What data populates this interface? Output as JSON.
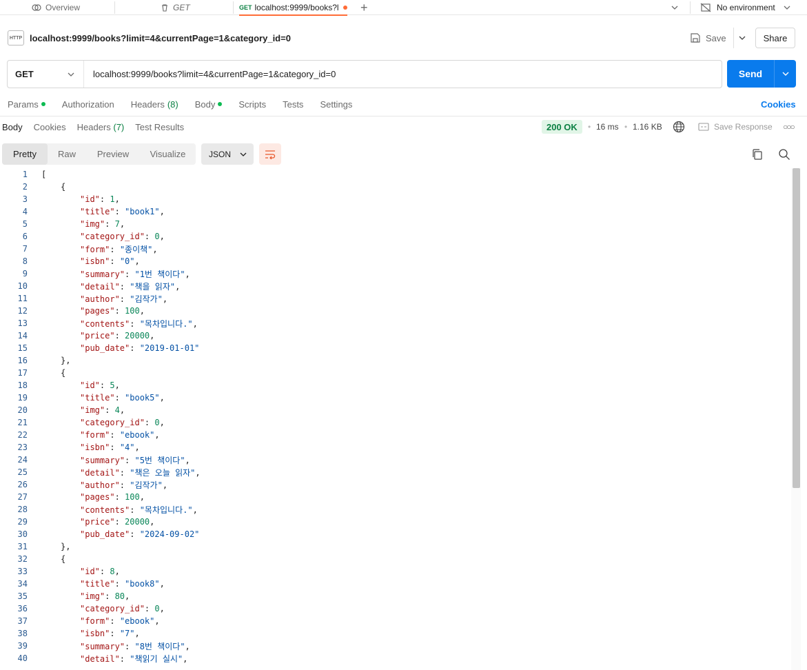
{
  "tabbar": {
    "tabs": [
      {
        "label": "Overview",
        "icon": "overview-icon"
      },
      {
        "label": "GET",
        "icon": "trash-icon"
      },
      {
        "method": "GET",
        "label": "localhost:9999/books?l",
        "icon": "unsaved-dot"
      }
    ],
    "environment": "No environment"
  },
  "request": {
    "badge": "HTTP",
    "name": "localhost:9999/books?limit=4&currentPage=1&category_id=0",
    "save_label": "Save",
    "share_label": "Share",
    "method": "GET",
    "url": "localhost:9999/books?limit=4&currentPage=1&category_id=0",
    "send_label": "Send",
    "tabs": [
      {
        "label": "Params",
        "dot": true
      },
      {
        "label": "Authorization"
      },
      {
        "label": "Headers",
        "count": "(8)"
      },
      {
        "label": "Body",
        "dot": true
      },
      {
        "label": "Scripts"
      },
      {
        "label": "Tests"
      },
      {
        "label": "Settings"
      }
    ],
    "cookies_label": "Cookies"
  },
  "response": {
    "tabs": [
      {
        "label": "Body"
      },
      {
        "label": "Cookies"
      },
      {
        "label": "Headers",
        "count": "(7)"
      },
      {
        "label": "Test Results"
      }
    ],
    "status": "200 OK",
    "time": "16 ms",
    "size": "1.16 KB",
    "save_response_label": "Save Response",
    "view_modes": [
      "Pretty",
      "Raw",
      "Preview",
      "Visualize"
    ],
    "format": "JSON",
    "colors": {
      "status_bg": "#e1f5e7",
      "status_text": "#0b8043",
      "send": "#097bed",
      "accent": "#ff6c37"
    }
  },
  "code_lines": [
    {
      "n": "1",
      "i": 0,
      "t": [
        [
          "p",
          "["
        ]
      ]
    },
    {
      "n": "2",
      "i": 1,
      "t": [
        [
          "p",
          "{"
        ]
      ]
    },
    {
      "n": "3",
      "i": 2,
      "t": [
        [
          "k",
          "\"id\""
        ],
        [
          "p",
          ": "
        ],
        [
          "n",
          "1"
        ],
        [
          "p",
          ","
        ]
      ]
    },
    {
      "n": "4",
      "i": 2,
      "t": [
        [
          "k",
          "\"title\""
        ],
        [
          "p",
          ": "
        ],
        [
          "s",
          "\"book1\""
        ],
        [
          "p",
          ","
        ]
      ]
    },
    {
      "n": "5",
      "i": 2,
      "t": [
        [
          "k",
          "\"img\""
        ],
        [
          "p",
          ": "
        ],
        [
          "n",
          "7"
        ],
        [
          "p",
          ","
        ]
      ]
    },
    {
      "n": "6",
      "i": 2,
      "t": [
        [
          "k",
          "\"category_id\""
        ],
        [
          "p",
          ": "
        ],
        [
          "n",
          "0"
        ],
        [
          "p",
          ","
        ]
      ]
    },
    {
      "n": "7",
      "i": 2,
      "t": [
        [
          "k",
          "\"form\""
        ],
        [
          "p",
          ": "
        ],
        [
          "s",
          "\"종이책\""
        ],
        [
          "p",
          ","
        ]
      ]
    },
    {
      "n": "8",
      "i": 2,
      "t": [
        [
          "k",
          "\"isbn\""
        ],
        [
          "p",
          ": "
        ],
        [
          "s",
          "\"0\""
        ],
        [
          "p",
          ","
        ]
      ]
    },
    {
      "n": "9",
      "i": 2,
      "t": [
        [
          "k",
          "\"summary\""
        ],
        [
          "p",
          ": "
        ],
        [
          "s",
          "\"1번 책이다\""
        ],
        [
          "p",
          ","
        ]
      ]
    },
    {
      "n": "10",
      "i": 2,
      "t": [
        [
          "k",
          "\"detail\""
        ],
        [
          "p",
          ": "
        ],
        [
          "s",
          "\"책을 읽자\""
        ],
        [
          "p",
          ","
        ]
      ]
    },
    {
      "n": "11",
      "i": 2,
      "t": [
        [
          "k",
          "\"author\""
        ],
        [
          "p",
          ": "
        ],
        [
          "s",
          "\"김작가\""
        ],
        [
          "p",
          ","
        ]
      ]
    },
    {
      "n": "12",
      "i": 2,
      "t": [
        [
          "k",
          "\"pages\""
        ],
        [
          "p",
          ": "
        ],
        [
          "n",
          "100"
        ],
        [
          "p",
          ","
        ]
      ]
    },
    {
      "n": "13",
      "i": 2,
      "t": [
        [
          "k",
          "\"contents\""
        ],
        [
          "p",
          ": "
        ],
        [
          "s",
          "\"목차입니다.\""
        ],
        [
          "p",
          ","
        ]
      ]
    },
    {
      "n": "14",
      "i": 2,
      "t": [
        [
          "k",
          "\"price\""
        ],
        [
          "p",
          ": "
        ],
        [
          "n",
          "20000"
        ],
        [
          "p",
          ","
        ]
      ]
    },
    {
      "n": "15",
      "i": 2,
      "t": [
        [
          "k",
          "\"pub_date\""
        ],
        [
          "p",
          ": "
        ],
        [
          "s",
          "\"2019-01-01\""
        ]
      ]
    },
    {
      "n": "16",
      "i": 1,
      "t": [
        [
          "p",
          "},"
        ]
      ]
    },
    {
      "n": "17",
      "i": 1,
      "t": [
        [
          "p",
          "{"
        ]
      ]
    },
    {
      "n": "18",
      "i": 2,
      "t": [
        [
          "k",
          "\"id\""
        ],
        [
          "p",
          ": "
        ],
        [
          "n",
          "5"
        ],
        [
          "p",
          ","
        ]
      ]
    },
    {
      "n": "19",
      "i": 2,
      "t": [
        [
          "k",
          "\"title\""
        ],
        [
          "p",
          ": "
        ],
        [
          "s",
          "\"book5\""
        ],
        [
          "p",
          ","
        ]
      ]
    },
    {
      "n": "20",
      "i": 2,
      "t": [
        [
          "k",
          "\"img\""
        ],
        [
          "p",
          ": "
        ],
        [
          "n",
          "4"
        ],
        [
          "p",
          ","
        ]
      ]
    },
    {
      "n": "21",
      "i": 2,
      "t": [
        [
          "k",
          "\"category_id\""
        ],
        [
          "p",
          ": "
        ],
        [
          "n",
          "0"
        ],
        [
          "p",
          ","
        ]
      ]
    },
    {
      "n": "22",
      "i": 2,
      "t": [
        [
          "k",
          "\"form\""
        ],
        [
          "p",
          ": "
        ],
        [
          "s",
          "\"ebook\""
        ],
        [
          "p",
          ","
        ]
      ]
    },
    {
      "n": "23",
      "i": 2,
      "t": [
        [
          "k",
          "\"isbn\""
        ],
        [
          "p",
          ": "
        ],
        [
          "s",
          "\"4\""
        ],
        [
          "p",
          ","
        ]
      ]
    },
    {
      "n": "24",
      "i": 2,
      "t": [
        [
          "k",
          "\"summary\""
        ],
        [
          "p",
          ": "
        ],
        [
          "s",
          "\"5번 책이다\""
        ],
        [
          "p",
          ","
        ]
      ]
    },
    {
      "n": "25",
      "i": 2,
      "t": [
        [
          "k",
          "\"detail\""
        ],
        [
          "p",
          ": "
        ],
        [
          "s",
          "\"책은 오늘 읽자\""
        ],
        [
          "p",
          ","
        ]
      ]
    },
    {
      "n": "26",
      "i": 2,
      "t": [
        [
          "k",
          "\"author\""
        ],
        [
          "p",
          ": "
        ],
        [
          "s",
          "\"김작가\""
        ],
        [
          "p",
          ","
        ]
      ]
    },
    {
      "n": "27",
      "i": 2,
      "t": [
        [
          "k",
          "\"pages\""
        ],
        [
          "p",
          ": "
        ],
        [
          "n",
          "100"
        ],
        [
          "p",
          ","
        ]
      ]
    },
    {
      "n": "28",
      "i": 2,
      "t": [
        [
          "k",
          "\"contents\""
        ],
        [
          "p",
          ": "
        ],
        [
          "s",
          "\"목차입니다.\""
        ],
        [
          "p",
          ","
        ]
      ]
    },
    {
      "n": "29",
      "i": 2,
      "t": [
        [
          "k",
          "\"price\""
        ],
        [
          "p",
          ": "
        ],
        [
          "n",
          "20000"
        ],
        [
          "p",
          ","
        ]
      ]
    },
    {
      "n": "30",
      "i": 2,
      "t": [
        [
          "k",
          "\"pub_date\""
        ],
        [
          "p",
          ": "
        ],
        [
          "s",
          "\"2024-09-02\""
        ]
      ]
    },
    {
      "n": "31",
      "i": 1,
      "t": [
        [
          "p",
          "},"
        ]
      ]
    },
    {
      "n": "32",
      "i": 1,
      "t": [
        [
          "p",
          "{"
        ]
      ]
    },
    {
      "n": "33",
      "i": 2,
      "t": [
        [
          "k",
          "\"id\""
        ],
        [
          "p",
          ": "
        ],
        [
          "n",
          "8"
        ],
        [
          "p",
          ","
        ]
      ]
    },
    {
      "n": "34",
      "i": 2,
      "t": [
        [
          "k",
          "\"title\""
        ],
        [
          "p",
          ": "
        ],
        [
          "s",
          "\"book8\""
        ],
        [
          "p",
          ","
        ]
      ]
    },
    {
      "n": "35",
      "i": 2,
      "t": [
        [
          "k",
          "\"img\""
        ],
        [
          "p",
          ": "
        ],
        [
          "n",
          "80"
        ],
        [
          "p",
          ","
        ]
      ]
    },
    {
      "n": "36",
      "i": 2,
      "t": [
        [
          "k",
          "\"category_id\""
        ],
        [
          "p",
          ": "
        ],
        [
          "n",
          "0"
        ],
        [
          "p",
          ","
        ]
      ]
    },
    {
      "n": "37",
      "i": 2,
      "t": [
        [
          "k",
          "\"form\""
        ],
        [
          "p",
          ": "
        ],
        [
          "s",
          "\"ebook\""
        ],
        [
          "p",
          ","
        ]
      ]
    },
    {
      "n": "38",
      "i": 2,
      "t": [
        [
          "k",
          "\"isbn\""
        ],
        [
          "p",
          ": "
        ],
        [
          "s",
          "\"7\""
        ],
        [
          "p",
          ","
        ]
      ]
    },
    {
      "n": "39",
      "i": 2,
      "t": [
        [
          "k",
          "\"summary\""
        ],
        [
          "p",
          ": "
        ],
        [
          "s",
          "\"8번 책이다\""
        ],
        [
          "p",
          ","
        ]
      ]
    },
    {
      "n": "40",
      "i": 2,
      "t": [
        [
          "k",
          "\"detail\""
        ],
        [
          "p",
          ": "
        ],
        [
          "s",
          "\"책읽기 실시\""
        ],
        [
          "p",
          ","
        ]
      ]
    }
  ]
}
